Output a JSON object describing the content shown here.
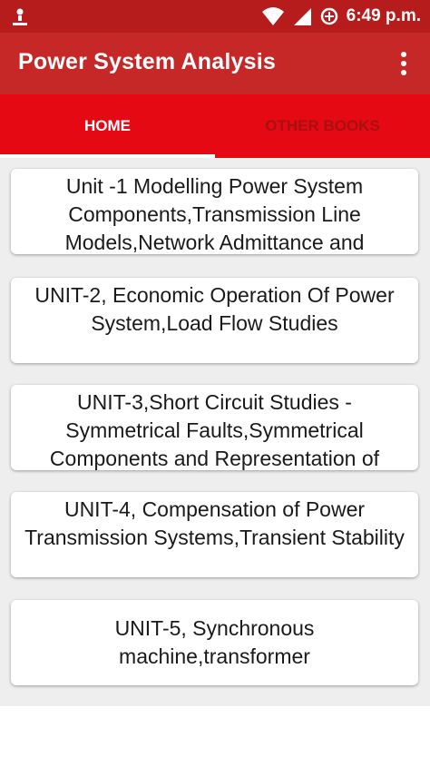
{
  "status_bar": {
    "time": "6:49 p.m.",
    "icons": [
      "notification-icon",
      "wifi-icon",
      "signal-icon",
      "data-saver-icon"
    ]
  },
  "app_bar": {
    "title": "Power System Analysis",
    "menu_icon": "more-vert-icon"
  },
  "tabs": [
    {
      "label": "HOME",
      "active": true
    },
    {
      "label": "OTHER BOOKS",
      "active": false
    }
  ],
  "units": [
    {
      "label": "Unit -1 Modelling Power System Components,Transmission Line Models,Network Admittance and"
    },
    {
      "label": "UNIT-2, Economic Operation Of Power System,Load Flow Studies"
    },
    {
      "label": "UNIT-3,Short Circuit Studies - Symmetrical Faults,Symmetrical Components and Representation of"
    },
    {
      "label": "UNIT-4, Compensation of Power Transmission Systems,Transient Stability"
    },
    {
      "label": "UNIT-5, Synchronous machine,transformer"
    }
  ],
  "colors": {
    "status_bar": "#b71c1c",
    "app_bar": "#c62828",
    "tab_bar": "#e50914",
    "inactive_tab": "#a81010"
  }
}
